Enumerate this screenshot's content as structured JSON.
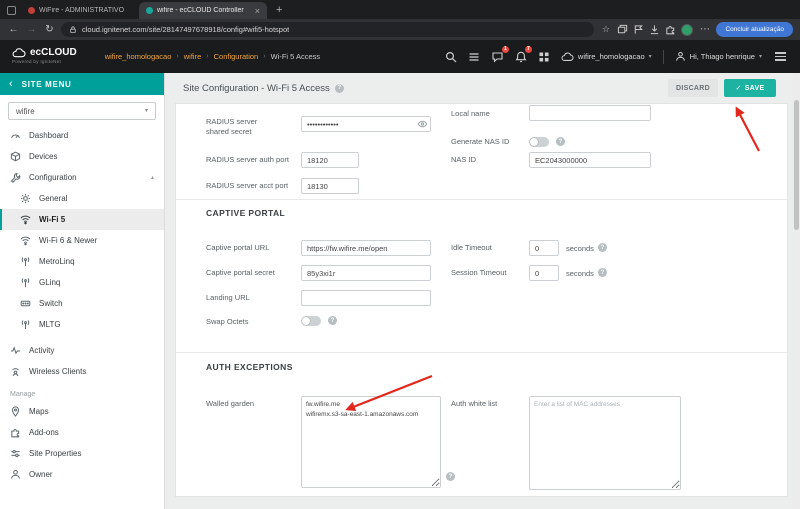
{
  "icons": {
    "close": "×",
    "new_tab": "+",
    "back": "←",
    "forward": "→",
    "reload": "↻",
    "star": "☆",
    "menu": "⋯",
    "caret_down": "▾",
    "caret_up": "▴",
    "chevron_left": "‹",
    "crumb_sep": "›",
    "question": "?",
    "check": "✓"
  },
  "colors": {
    "teal_accent": "#1db3a2",
    "sitemenu_teal": "#00a09a",
    "breadcrumb_orange": "#f0a63c",
    "badge_red": "#e8483f",
    "arrow_red": "#e0281c",
    "update_blue": "#4076d4"
  },
  "browser": {
    "tab1_title": "WiFire - ADMINISTRATIVO",
    "tab2_title": "wifire - ecCLOUD Controller",
    "url": "cloud.ignitenet.com/site/28147497678918/config#wifi5-hotspot",
    "update_button": "Concluir atualização"
  },
  "header": {
    "logo_text": "ecCLOUD",
    "logo_tagline": "Powered by IgniteNet",
    "chat_badge": "1",
    "bell_badge": "7",
    "account_name": "wifire_homologacao",
    "greeting": "Hi, Thiago henrique",
    "breadcrumb": {
      "site_group": "wifire_homologacao",
      "site": "wifire",
      "section": "Configuration",
      "page": "Wi-Fi 5 Access"
    }
  },
  "sidebar": {
    "title": "SITE MENU",
    "site_select": "wifire",
    "items": {
      "dashboard": "Dashboard",
      "devices": "Devices",
      "configuration": "Configuration",
      "general": "General",
      "wifi5": "Wi-Fi 5",
      "wifi6": "Wi-Fi 6 & Newer",
      "metrolinq": "MetroLinq",
      "glinq": "GLinq",
      "switch": "Switch",
      "mltg": "MLTG",
      "activity": "Activity",
      "wireless_clients": "Wireless Clients"
    },
    "manage_label": "Manage",
    "manage": {
      "maps": "Maps",
      "addons": "Add-ons",
      "site_properties": "Site Properties",
      "owner": "Owner"
    }
  },
  "page": {
    "title": "Site Configuration - Wi-Fi 5 Access",
    "discard_button": "DISCARD",
    "save_button": "SAVE"
  },
  "form": {
    "radius": {
      "shared_secret_label": "RADIUS server shared secret",
      "shared_secret_value": "••••••••••••",
      "auth_port_label": "RADIUS server auth port",
      "auth_port_value": "18120",
      "acct_port_label": "RADIUS server acct port",
      "acct_port_value": "18130",
      "local_name_label": "Local name",
      "local_name_value": "",
      "generate_nas_id_label": "Generate NAS ID",
      "nas_id_label": "NAS ID",
      "nas_id_value": "EC2043000000"
    },
    "captive_portal": {
      "section_title": "CAPTIVE PORTAL",
      "url_label": "Captive portal URL",
      "url_value": "https://fw.wifire.me/open",
      "secret_label": "Captive portal secret",
      "secret_value": "85y3xi1r",
      "landing_url_label": "Landing URL",
      "landing_url_value": "",
      "swap_octets_label": "Swap Octets",
      "idle_timeout_label": "Idle Timeout",
      "idle_timeout_value": "0",
      "idle_timeout_unit": "seconds",
      "session_timeout_label": "Session Timeout",
      "session_timeout_value": "0",
      "session_timeout_unit": "seconds"
    },
    "auth_exceptions": {
      "section_title": "AUTH EXCEPTIONS",
      "walled_garden_label": "Walled garden",
      "walled_garden_value": "fw.wifire.me\nwifiremx.s3-sa-east-1.amazonaws.com",
      "auth_white_list_label": "Auth white list",
      "auth_white_list_placeholder": "Enter a list of MAC addresses"
    }
  }
}
